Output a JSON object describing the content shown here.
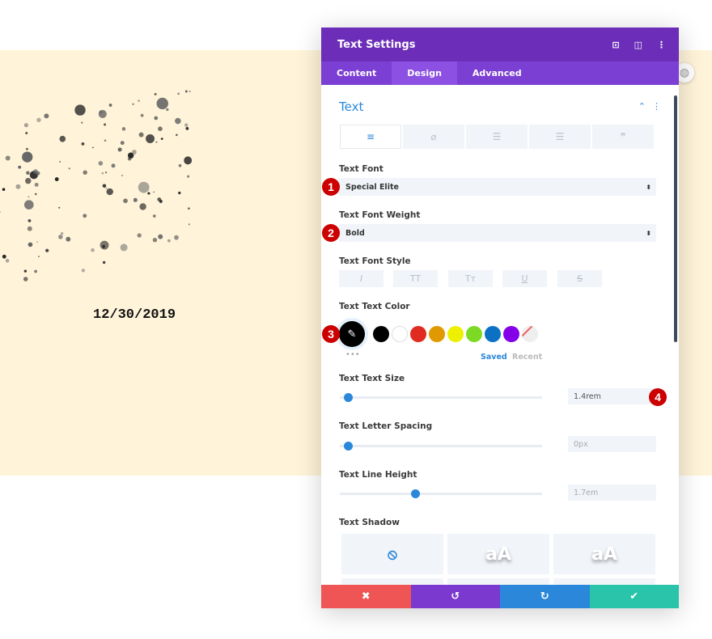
{
  "preview": {
    "date_text": "12/30/2019"
  },
  "panel": {
    "title": "Text Settings",
    "header_icons": [
      "focus-icon",
      "split-view-icon",
      "more-vertical-icon"
    ],
    "tabs": [
      {
        "label": "Content"
      },
      {
        "label": "Design",
        "active": true
      },
      {
        "label": "Advanced"
      }
    ],
    "section_title": "Text",
    "text_align_tabs": [
      "align-left-icon",
      "link-off-icon",
      "unordered-list-icon",
      "ordered-list-icon",
      "quote-icon"
    ],
    "font": {
      "label": "Text Font",
      "value": "Special Elite"
    },
    "weight": {
      "label": "Text Font Weight",
      "value": "Bold"
    },
    "style": {
      "label": "Text Font Style",
      "buttons": [
        "I",
        "TT",
        "Tт",
        "U",
        "S"
      ]
    },
    "color": {
      "label": "Text Text Color",
      "selected": "#000000",
      "swatches": [
        "#000000",
        "#ffffff",
        "#e02b20",
        "#e09900",
        "#edf000",
        "#7cda24",
        "#0c71c3",
        "#8300e9"
      ],
      "saved_label": "Saved",
      "recent_label": "Recent"
    },
    "size": {
      "label": "Text Text Size",
      "value": "1.4rem",
      "slider_percent": 2
    },
    "spacing": {
      "label": "Text Letter Spacing",
      "value": "0px",
      "slider_percent": 2
    },
    "line_height": {
      "label": "Text Line Height",
      "value": "1.7em",
      "slider_percent": 36
    },
    "shadow": {
      "label": "Text Shadow",
      "presets": [
        "none",
        "aA",
        "aA"
      ]
    },
    "badges": [
      "1",
      "2",
      "3",
      "4"
    ],
    "footer": {
      "colors": [
        "#ef5555",
        "#7b39cf",
        "#2b87da",
        "#29c4a9"
      ]
    }
  }
}
